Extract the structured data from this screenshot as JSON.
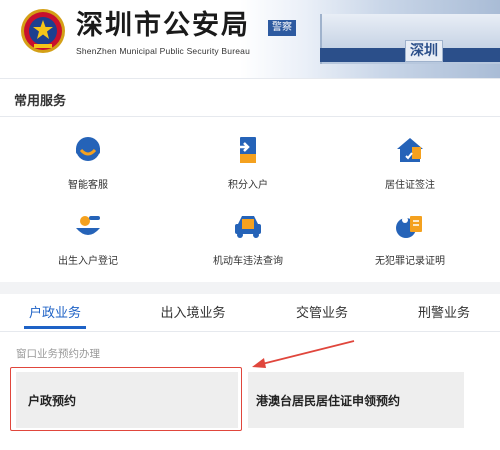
{
  "header": {
    "title": "深圳市公安局",
    "subtitle": "ShenZhen Municipal Public Security Bureau",
    "logo_icon": "police-emblem-icon",
    "photo_sign_1": "警察",
    "photo_sign_2": "深圳"
  },
  "common_services": {
    "title": "常用服务",
    "items": [
      {
        "label": "智能客服",
        "icon": "customer-service-icon"
      },
      {
        "label": "积分入户",
        "icon": "points-settle-icon"
      },
      {
        "label": "居住证签注",
        "icon": "residence-permit-icon"
      },
      {
        "label": "出生入户登记",
        "icon": "birth-registration-icon"
      },
      {
        "label": "机动车违法查询",
        "icon": "vehicle-violation-icon"
      },
      {
        "label": "无犯罪记录证明",
        "icon": "no-crime-record-icon"
      }
    ]
  },
  "tabs": [
    {
      "label": "户政业务",
      "active": true
    },
    {
      "label": "出入境业务",
      "active": false
    },
    {
      "label": "交管业务",
      "active": false
    },
    {
      "label": "刑警业务",
      "active": false
    }
  ],
  "window_section": {
    "heading": "窗口业务预约办理",
    "cards": [
      {
        "label": "户政预约",
        "highlighted": true
      },
      {
        "label": "港澳台居民居住证申领预约",
        "highlighted": false
      }
    ]
  },
  "colors": {
    "accent": "#1e62c6",
    "icon_blue": "#2563b8",
    "icon_orange": "#f4a11f",
    "highlight_red": "#e0463c"
  }
}
